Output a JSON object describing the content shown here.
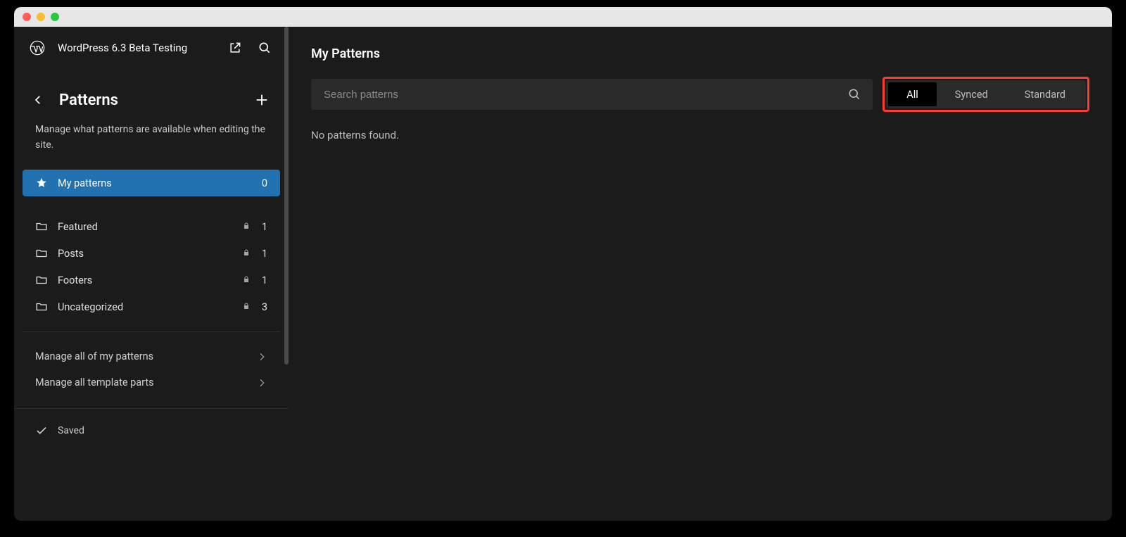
{
  "site": {
    "name": "WordPress 6.3 Beta Testing"
  },
  "header": {
    "title": "Patterns",
    "description": "Manage what patterns are available when editing the site."
  },
  "sidebar": {
    "items": [
      {
        "label": "My patterns",
        "count": "0",
        "icon": "star"
      },
      {
        "label": "Featured",
        "count": "1",
        "icon": "folder",
        "locked": true
      },
      {
        "label": "Posts",
        "count": "1",
        "icon": "folder",
        "locked": true
      },
      {
        "label": "Footers",
        "count": "1",
        "icon": "folder",
        "locked": true
      },
      {
        "label": "Uncategorized",
        "count": "3",
        "icon": "folder",
        "locked": true
      }
    ],
    "links": [
      {
        "label": "Manage all of my patterns"
      },
      {
        "label": "Manage all template parts"
      }
    ],
    "footer": {
      "status": "Saved"
    }
  },
  "main": {
    "title": "My Patterns",
    "search_placeholder": "Search patterns",
    "tabs": [
      {
        "label": "All"
      },
      {
        "label": "Synced"
      },
      {
        "label": "Standard"
      }
    ],
    "empty": "No patterns found."
  }
}
